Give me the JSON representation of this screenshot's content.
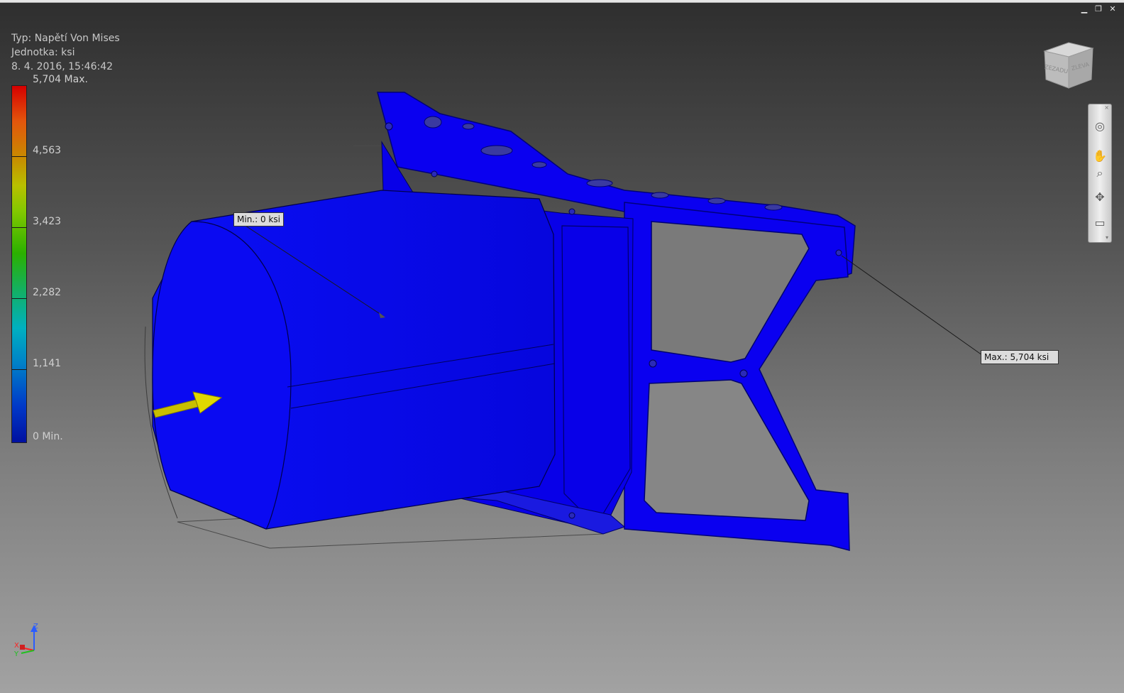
{
  "window": {
    "minimize_glyph": "▁",
    "restore_glyph": "❐",
    "close_glyph": "✕"
  },
  "legend": {
    "type_line": "Typ: Napětí Von Mises",
    "unit_line": "Jednotka: ksi",
    "date_line": "8. 4. 2016, 15:46:42",
    "scale": {
      "max_label": "5,704 Max.",
      "tick_1": "4,563",
      "tick_2": "3,423",
      "tick_3": "2,282",
      "tick_4": "1,141",
      "min_label": "0 Min."
    }
  },
  "viewcube": {
    "face_left": "ZEZADU",
    "face_right": "ZLEVA"
  },
  "navbar": {
    "close_glyph": "×",
    "steering_wheel_icon": "steering-wheel-icon",
    "pan_icon": "pan-icon",
    "zoom_icon": "zoom-icon",
    "orbit_icon": "orbit-icon",
    "look_at_icon": "look-at-icon"
  },
  "callouts": {
    "min": "Min.: 0 ksi",
    "max": "Max.: 5,704 ksi"
  },
  "triad": {
    "z": "Z",
    "x": "X",
    "y": "Y"
  },
  "colors": {
    "stress_low": "#0a00f0",
    "load_arrow": "#d0c800",
    "scale_max": "#d50000",
    "scale_min": "#0010a0"
  }
}
